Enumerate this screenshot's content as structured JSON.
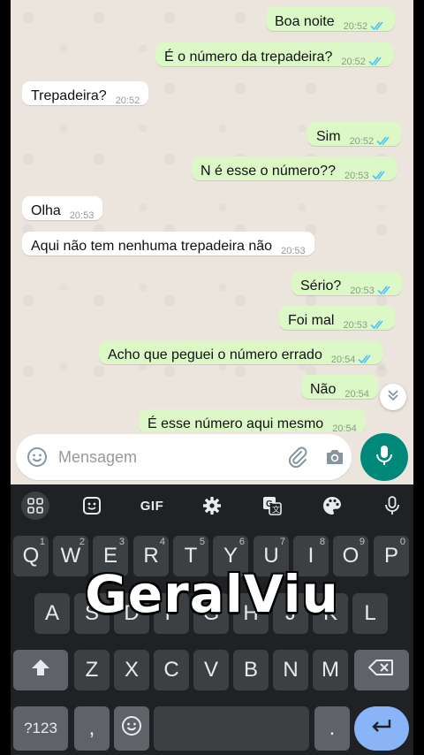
{
  "messages": [
    {
      "text": "Boa noite",
      "time": "20:52",
      "dir": "out"
    },
    {
      "text": "É o número da trepadeira?",
      "time": "20:52",
      "dir": "out"
    },
    {
      "text": "Trepadeira?",
      "time": "20:52",
      "dir": "in"
    },
    {
      "text": "Sim",
      "time": "20:52",
      "dir": "out"
    },
    {
      "text": "N é esse o número??",
      "time": "20:53",
      "dir": "out"
    },
    {
      "text": "Olha",
      "time": "20:53",
      "dir": "in"
    },
    {
      "text": "Aqui não tem nenhuma trepadeira não",
      "time": "20:53",
      "dir": "in"
    },
    {
      "text": "Sério?",
      "time": "20:53",
      "dir": "out"
    },
    {
      "text": "Foi mal",
      "time": "20:53",
      "dir": "out"
    },
    {
      "text": "Acho que peguei o número errado",
      "time": "20:54",
      "dir": "out"
    },
    {
      "text": "Não",
      "time": "20:54",
      "dir": "out"
    },
    {
      "text": "É esse número aqui mesmo",
      "time": "20:54",
      "dir": "out"
    }
  ],
  "composer": {
    "placeholder": "Mensagem"
  },
  "keyboard": {
    "toolbar": {
      "gif_label": "GIF"
    },
    "row1": [
      {
        "key": "Q",
        "hint": "1"
      },
      {
        "key": "W",
        "hint": "2"
      },
      {
        "key": "E",
        "hint": "3"
      },
      {
        "key": "R",
        "hint": "4"
      },
      {
        "key": "T",
        "hint": "5"
      },
      {
        "key": "Y",
        "hint": "6"
      },
      {
        "key": "U",
        "hint": "7"
      },
      {
        "key": "I",
        "hint": "8"
      },
      {
        "key": "O",
        "hint": "9"
      },
      {
        "key": "P",
        "hint": "0"
      }
    ],
    "row2": [
      "A",
      "S",
      "D",
      "F",
      "G",
      "H",
      "J",
      "K",
      "L"
    ],
    "row3": [
      "Z",
      "X",
      "C",
      "V",
      "B",
      "N",
      "M"
    ],
    "row4": {
      "symbols": "?123",
      "comma": ",",
      "period": "."
    }
  },
  "watermark": "GeralViu",
  "colors": {
    "outgoing": "#dcf8c6",
    "incoming": "#ffffff",
    "read_ticks": "#4fc3f7",
    "accent": "#00897b",
    "enter_key": "#8ab4f8"
  }
}
